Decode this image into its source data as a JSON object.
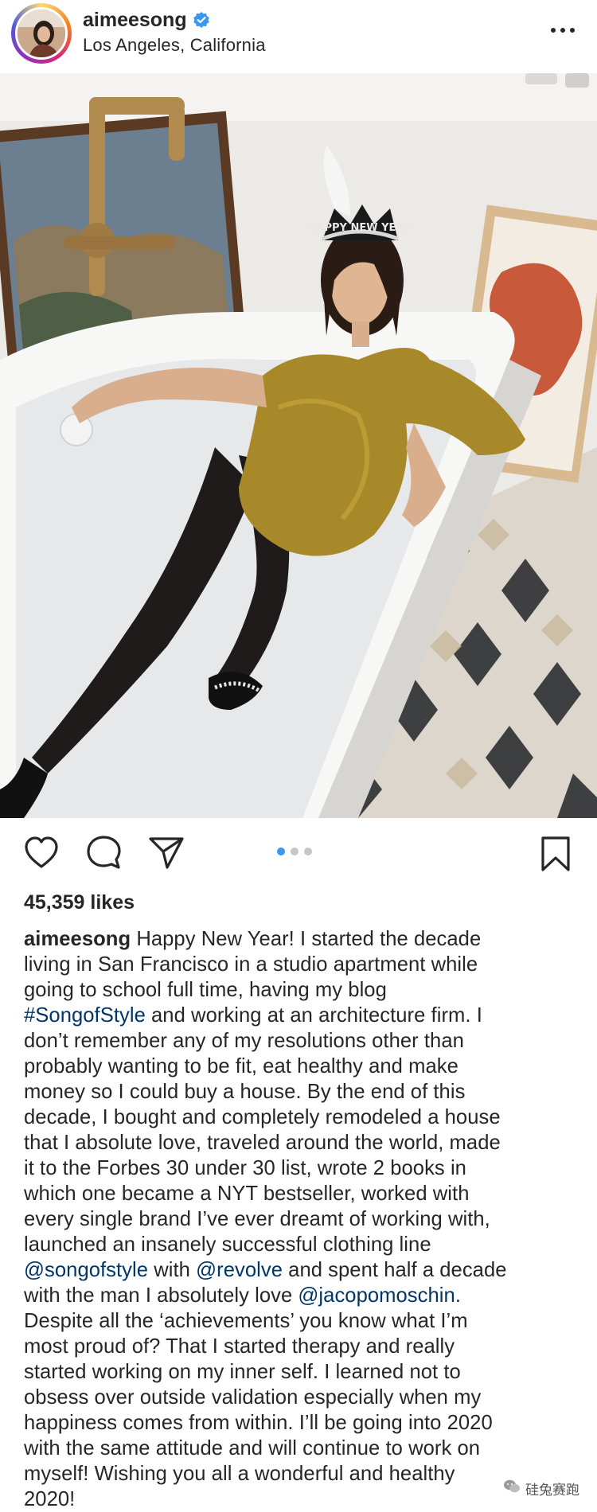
{
  "header": {
    "username": "aimeesong",
    "location": "Los Angeles, California"
  },
  "post": {
    "likes": "45,359 likes",
    "carousel": {
      "count": 3,
      "active": 0
    }
  },
  "caption": {
    "lines": [
      [
        {
          "t": "aimeesong",
          "k": "user"
        },
        {
          "t": " Happy New Year! I started the decade",
          "k": "text"
        }
      ],
      [
        {
          "t": "living in San Francisco in a studio apartment while",
          "k": "text"
        }
      ],
      [
        {
          "t": "going to school full time, having my blog",
          "k": "text"
        }
      ],
      [
        {
          "t": "#SongofStyle",
          "k": "link"
        },
        {
          "t": " and working at an architecture firm. I",
          "k": "text"
        }
      ],
      [
        {
          "t": "don’t remember any of my resolutions other than",
          "k": "text"
        }
      ],
      [
        {
          "t": "probably wanting to be fit, eat healthy and make",
          "k": "text"
        }
      ],
      [
        {
          "t": "money so I could buy a house. By the end of this",
          "k": "text"
        }
      ],
      [
        {
          "t": "decade, I bought and completely remodeled a house",
          "k": "text"
        }
      ],
      [
        {
          "t": "that I absolute love, traveled around the world, made",
          "k": "text"
        }
      ],
      [
        {
          "t": "it to the Forbes 30 under 30 list, wrote 2 books in",
          "k": "text"
        }
      ],
      [
        {
          "t": "which one became a NYT bestseller, worked with",
          "k": "text"
        }
      ],
      [
        {
          "t": "every single brand I’ve ever dreamt of working with,",
          "k": "text"
        }
      ],
      [
        {
          "t": "launched an insanely successful clothing line",
          "k": "text"
        }
      ],
      [
        {
          "t": "@songofstyle",
          "k": "link"
        },
        {
          "t": " with ",
          "k": "text"
        },
        {
          "t": "@revolve",
          "k": "link"
        },
        {
          "t": " and spent half a decade",
          "k": "text"
        }
      ],
      [
        {
          "t": "with the man I absolutely love ",
          "k": "text"
        },
        {
          "t": "@jacopomoschin",
          "k": "link"
        },
        {
          "t": ".",
          "k": "text"
        }
      ],
      [
        {
          "t": "Despite all the ‘achievements’ you know what I’m",
          "k": "text"
        }
      ],
      [
        {
          "t": "most proud of? That I started therapy and really",
          "k": "text"
        }
      ],
      [
        {
          "t": "started working on my inner self. I learned not to",
          "k": "text"
        }
      ],
      [
        {
          "t": "obsess over outside validation especially when my",
          "k": "text"
        }
      ],
      [
        {
          "t": "happiness comes from within. I’ll be going into 2020",
          "k": "text"
        }
      ],
      [
        {
          "t": "with the same attitude and will continue to work on",
          "k": "text"
        }
      ],
      [
        {
          "t": "myself! Wishing you all a wonderful and healthy",
          "k": "text"
        }
      ],
      [
        {
          "t": "2020!",
          "k": "text"
        }
      ]
    ]
  },
  "photo": {
    "tiara_text": "HAPPY NEW YEAR"
  },
  "watermark": {
    "text": "硅兔赛跑"
  },
  "icons": {
    "verified": "verified-badge-icon",
    "more": "more-options-icon",
    "like": "heart-icon",
    "comment": "comment-bubble-icon",
    "share": "paper-plane-icon",
    "save": "bookmark-icon"
  },
  "colors": {
    "verified_blue": "#3897f0",
    "link": "#003569",
    "carousel_active": "#3897f0",
    "carousel_inactive": "#c7c7c7"
  }
}
